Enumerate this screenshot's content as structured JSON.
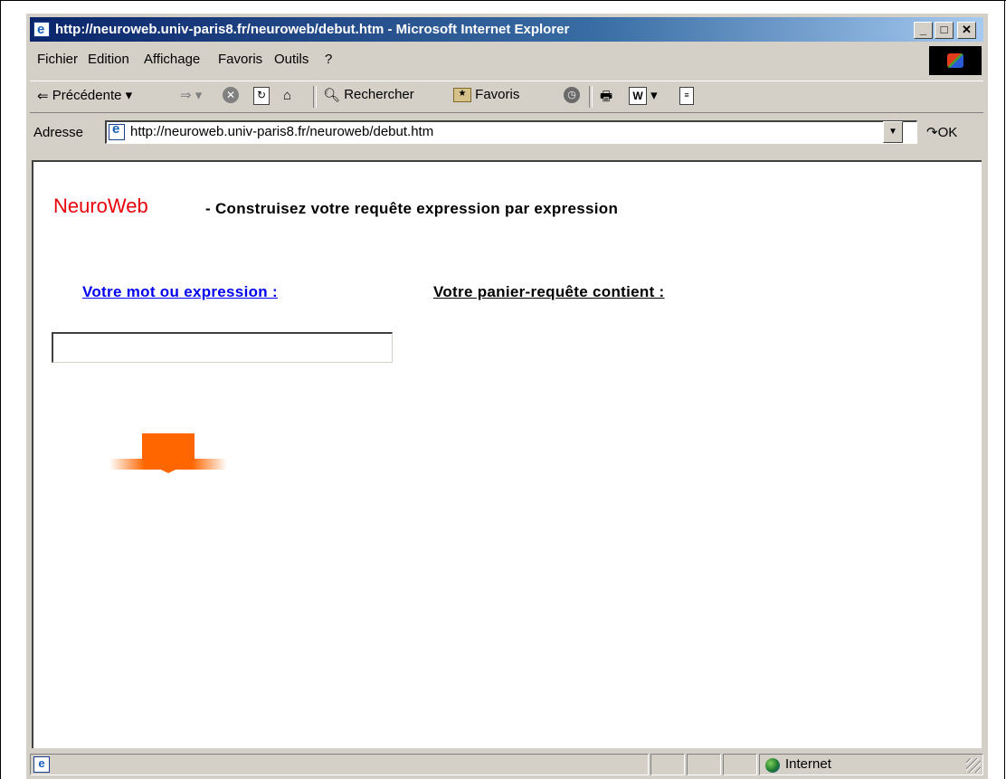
{
  "window": {
    "title": "http://neuroweb.univ-paris8.fr/neuroweb/debut.htm - Microsoft Internet Explorer",
    "controls": [
      "_",
      "□",
      "✕"
    ]
  },
  "menubar": {
    "items": [
      "Fichier",
      "Edition",
      "Affichage",
      "Favoris",
      "Outils",
      "?"
    ]
  },
  "toolbar": {
    "back_label": "Précédente",
    "search_label": "Rechercher",
    "favorites_label": "Favoris"
  },
  "addressbar": {
    "label": "Adresse",
    "url": "http://neuroweb.univ-paris8.fr/neuroweb/debut.htm",
    "go_label": "OK"
  },
  "page": {
    "brand": "NeuroWeb",
    "headline": " - Construisez votre requête expression par expression",
    "expression_link": "Votre mot ou expression :",
    "basket_label": "Votre panier-requête contient :",
    "expression_value": "",
    "arrow_color": "#ff6600"
  },
  "statusbar": {
    "zone": "Internet"
  }
}
